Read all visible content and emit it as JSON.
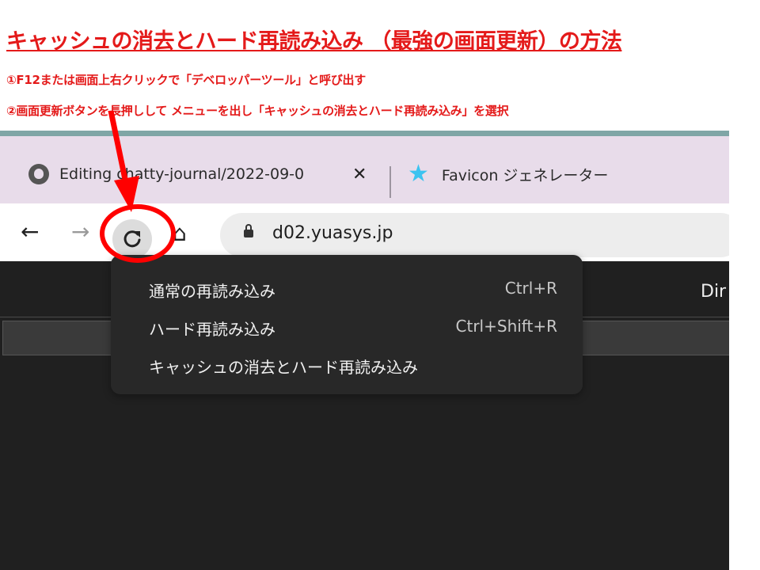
{
  "annotation": {
    "title": "キャッシュの消去とハード再読み込み （最強の画面更新）の方法",
    "step1": "①F12または画面上右クリックで「デベロッパーツール」と呼び出す",
    "step2": "②画面更新ボタンを長押しして メニューを出し「キャッシュの消去とハード再読み込み」を選択",
    "accent_color": "#e41a1a"
  },
  "browser": {
    "tabs": [
      {
        "label": "Editing chatty-journal/2022-09-0",
        "icon": "github-icon",
        "close": "✕"
      },
      {
        "label": "Favicon ジェネレーター",
        "icon": "star-icon"
      }
    ],
    "toolbar": {
      "back": "←",
      "forward": "→",
      "home": "⌂",
      "url": "d02.yuasys.jp"
    },
    "page_text": "Dir"
  },
  "context_menu": {
    "items": [
      {
        "label": "通常の再読み込み",
        "shortcut": "Ctrl+R"
      },
      {
        "label": "ハード再読み込み",
        "shortcut": "Ctrl+Shift+R"
      },
      {
        "label": "キャッシュの消去とハード再読み込み",
        "shortcut": ""
      }
    ]
  }
}
